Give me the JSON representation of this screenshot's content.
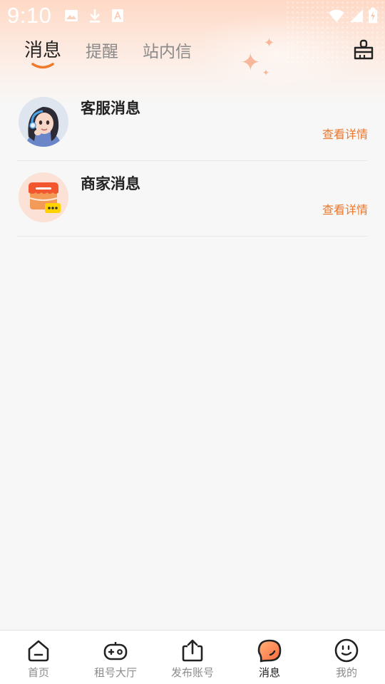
{
  "status_bar": {
    "time": "9:10",
    "left_icons": [
      "image-icon",
      "download-icon",
      "font-icon"
    ],
    "right_icons": [
      "wifi-icon",
      "signal-icon",
      "battery-charging-icon"
    ]
  },
  "tabs": [
    {
      "label": "消息",
      "active": true
    },
    {
      "label": "提醒",
      "active": false
    },
    {
      "label": "站内信",
      "active": false
    }
  ],
  "header": {
    "clean_icon": "broom-icon"
  },
  "messages": [
    {
      "title": "客服消息",
      "link": "查看详情",
      "avatar": "customer-service-avatar"
    },
    {
      "title": "商家消息",
      "link": "查看详情",
      "avatar": "merchant-shop-icon"
    }
  ],
  "bottom_nav": [
    {
      "label": "首页",
      "icon": "home-icon",
      "active": false
    },
    {
      "label": "租号大厅",
      "icon": "gamepad-icon",
      "active": false
    },
    {
      "label": "发布账号",
      "icon": "upload-icon",
      "active": false
    },
    {
      "label": "消息",
      "icon": "message-icon",
      "active": true
    },
    {
      "label": "我的",
      "icon": "profile-face-icon",
      "active": false
    }
  ],
  "colors": {
    "accent": "#e8772e",
    "indicator": "#ef7a2b",
    "gradient_top": "#ffd9c6",
    "background": "#f7f7f7"
  }
}
